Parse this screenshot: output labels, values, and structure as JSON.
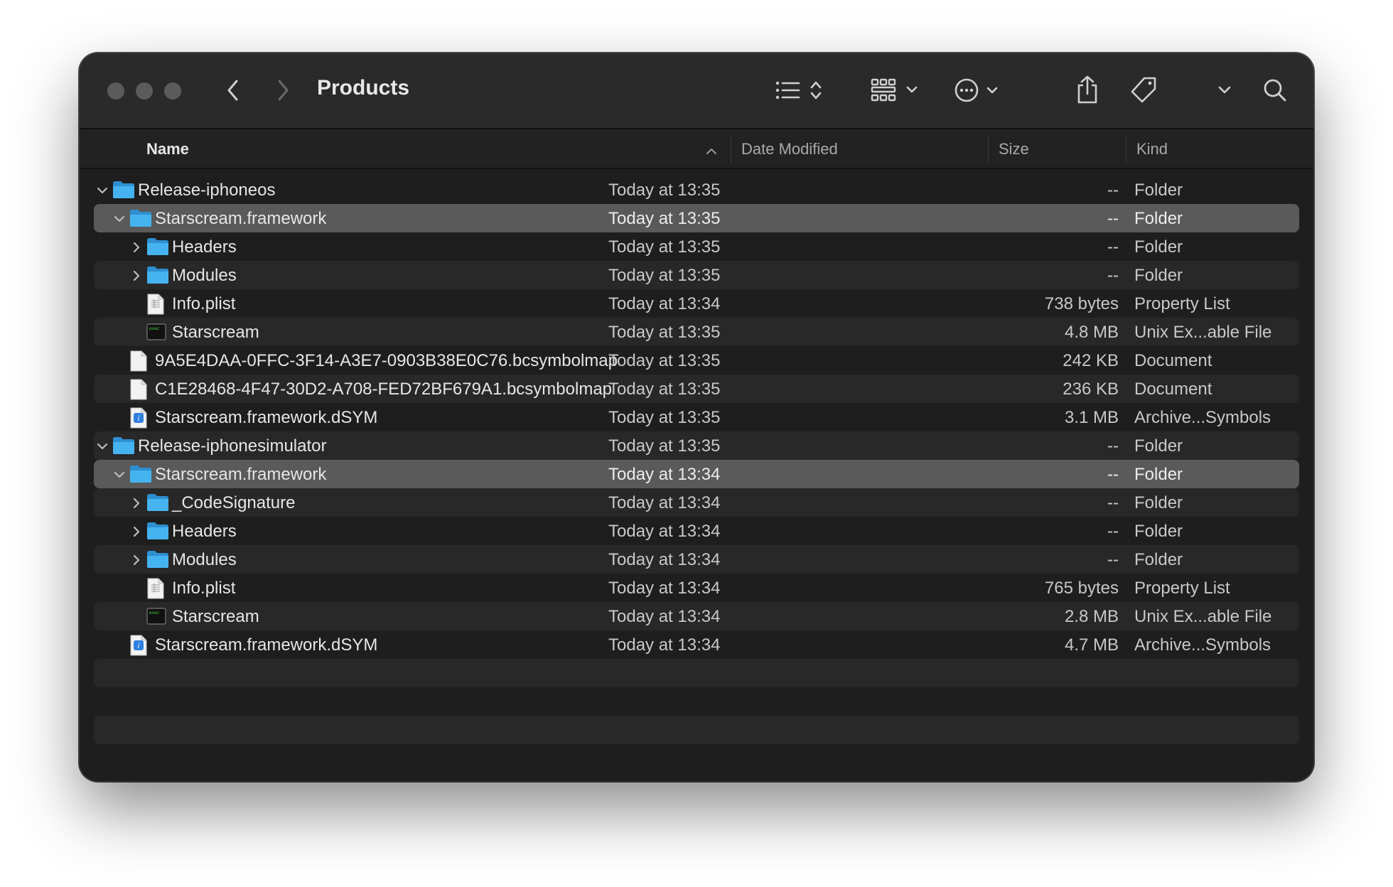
{
  "window": {
    "title": "Products"
  },
  "columns": {
    "name": "Name",
    "date": "Date Modified",
    "size": "Size",
    "kind": "Kind"
  },
  "icons": {
    "back": "chevron-left-icon",
    "forward": "chevron-right-icon",
    "view_list": "list-view-icon",
    "group": "grid-group-icon",
    "more": "ellipsis-circle-icon",
    "share": "share-icon",
    "tag": "tag-icon",
    "search": "search-icon"
  },
  "colors": {
    "folder": "#45b3f0",
    "selection": "#5a5a5a"
  },
  "rows": [
    {
      "name": "Release-iphoneos",
      "date": "Today at 13:35",
      "size": "--",
      "kind": "Folder",
      "type": "folder",
      "level": 0,
      "expanded": true
    },
    {
      "name": "Starscream.framework",
      "date": "Today at 13:35",
      "size": "--",
      "kind": "Folder",
      "type": "folder",
      "level": 1,
      "expanded": true,
      "selected": true
    },
    {
      "name": "Headers",
      "date": "Today at 13:35",
      "size": "--",
      "kind": "Folder",
      "type": "folder",
      "level": 2,
      "expanded": false
    },
    {
      "name": "Modules",
      "date": "Today at 13:35",
      "size": "--",
      "kind": "Folder",
      "type": "folder",
      "level": 2,
      "expanded": false
    },
    {
      "name": "Info.plist",
      "date": "Today at 13:34",
      "size": "738 bytes",
      "kind": "Property List",
      "type": "plist",
      "level": 2
    },
    {
      "name": "Starscream",
      "date": "Today at 13:35",
      "size": "4.8 MB",
      "kind": "Unix Ex...able File",
      "type": "exec",
      "level": 2
    },
    {
      "name": "9A5E4DAA-0FFC-3F14-A3E7-0903B38E0C76.bcsymbolmap",
      "date": "Today at 13:35",
      "size": "242 KB",
      "kind": "Document",
      "type": "doc",
      "level": 1
    },
    {
      "name": "C1E28468-4F47-30D2-A708-FED72BF679A1.bcsymbolmap",
      "date": "Today at 13:35",
      "size": "236 KB",
      "kind": "Document",
      "type": "doc",
      "level": 1
    },
    {
      "name": "Starscream.framework.dSYM",
      "date": "Today at 13:35",
      "size": "3.1 MB",
      "kind": "Archive...Symbols",
      "type": "dsym",
      "level": 1
    },
    {
      "name": "Release-iphonesimulator",
      "date": "Today at 13:35",
      "size": "--",
      "kind": "Folder",
      "type": "folder",
      "level": 0,
      "expanded": true
    },
    {
      "name": "Starscream.framework",
      "date": "Today at 13:34",
      "size": "--",
      "kind": "Folder",
      "type": "folder",
      "level": 1,
      "expanded": true,
      "selected": true
    },
    {
      "name": "_CodeSignature",
      "date": "Today at 13:34",
      "size": "--",
      "kind": "Folder",
      "type": "folder",
      "level": 2,
      "expanded": false
    },
    {
      "name": "Headers",
      "date": "Today at 13:34",
      "size": "--",
      "kind": "Folder",
      "type": "folder",
      "level": 2,
      "expanded": false
    },
    {
      "name": "Modules",
      "date": "Today at 13:34",
      "size": "--",
      "kind": "Folder",
      "type": "folder",
      "level": 2,
      "expanded": false
    },
    {
      "name": "Info.plist",
      "date": "Today at 13:34",
      "size": "765 bytes",
      "kind": "Property List",
      "type": "plist",
      "level": 2
    },
    {
      "name": "Starscream",
      "date": "Today at 13:34",
      "size": "2.8 MB",
      "kind": "Unix Ex...able File",
      "type": "exec",
      "level": 2
    },
    {
      "name": "Starscream.framework.dSYM",
      "date": "Today at 13:34",
      "size": "4.7 MB",
      "kind": "Archive...Symbols",
      "type": "dsym",
      "level": 1
    }
  ]
}
